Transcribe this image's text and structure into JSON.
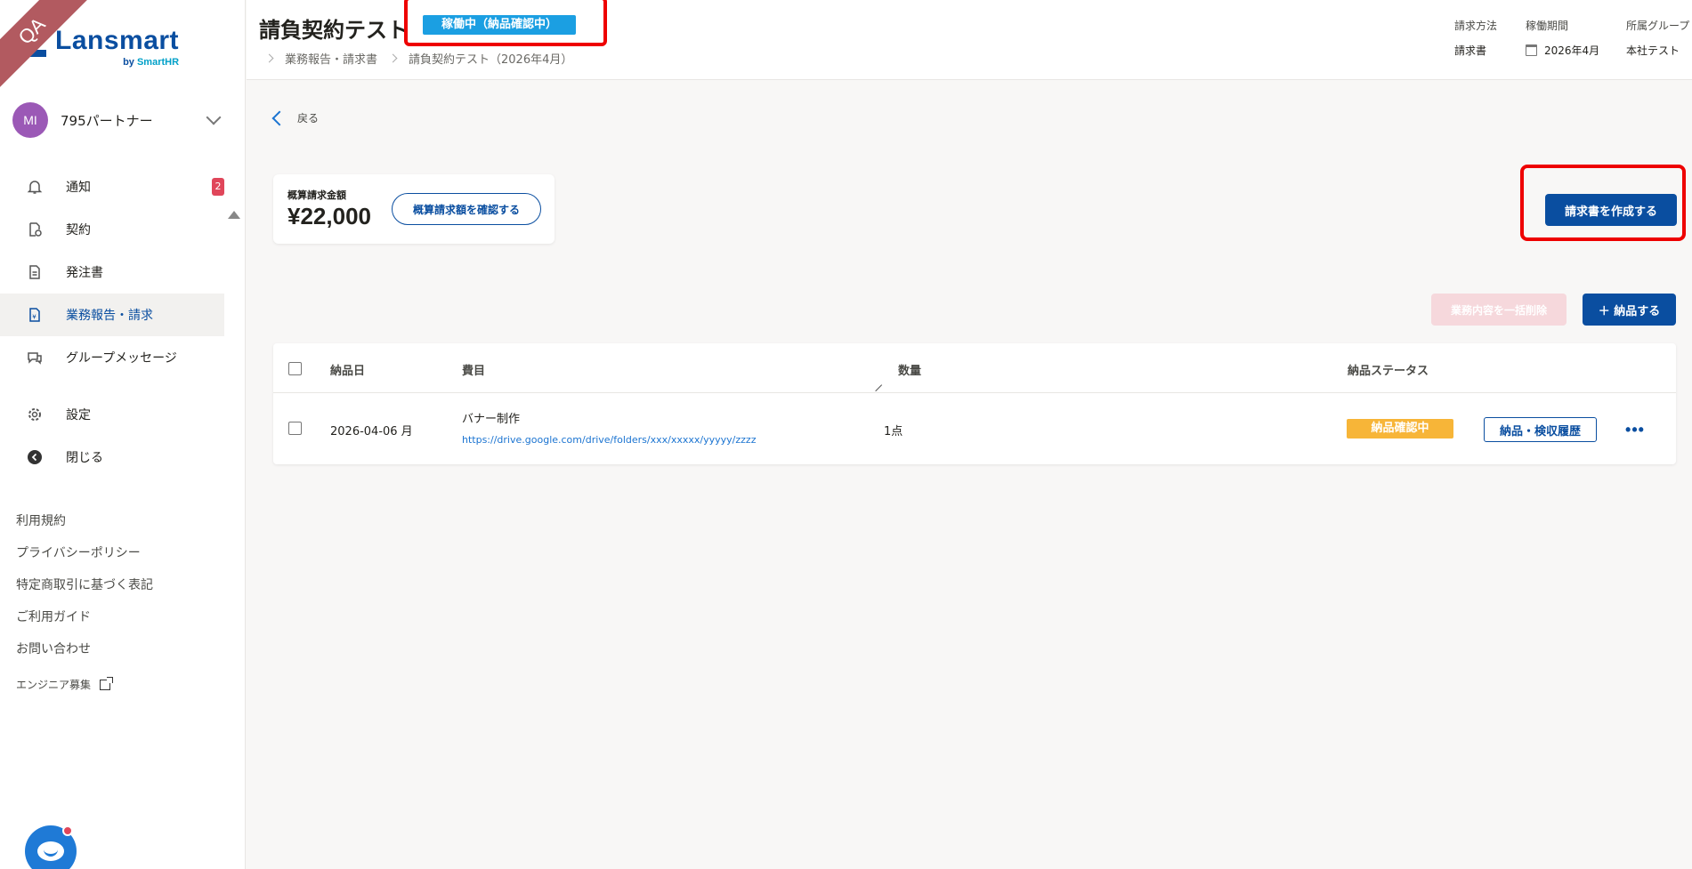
{
  "sidebar": {
    "qa_ribbon": "QA",
    "logo": {
      "name": "Lansmart",
      "by": "by ",
      "brand": "SmartHR"
    },
    "account": {
      "initials": "MI",
      "name": "795パートナー"
    },
    "nav": [
      {
        "label": "通知",
        "icon": "bell-icon",
        "badge": "2"
      },
      {
        "label": "契約",
        "icon": "contract-icon"
      },
      {
        "label": "発注書",
        "icon": "document-icon"
      },
      {
        "label": "業務報告・請求",
        "icon": "invoice-icon",
        "active": true
      },
      {
        "label": "グループメッセージ",
        "icon": "chat-icon"
      },
      {
        "label": "設定",
        "icon": "gear-icon"
      },
      {
        "label": "閉じる",
        "icon": "close-sidebar-icon"
      }
    ],
    "footer_links": [
      "利用規約",
      "プライバシーポリシー",
      "特定商取引に基づく表記",
      "ご利用ガイド",
      "お問い合わせ",
      "エンジニア募集"
    ]
  },
  "header": {
    "title": "請負契約テスト",
    "status": "稼働中（納品確認中）",
    "breadcrumb": [
      "業務報告・請求書",
      "請負契約テスト（2026年4月）"
    ],
    "meta": [
      {
        "label": "請求方法",
        "value": "請求書"
      },
      {
        "label": "稼働期間",
        "value": "2026年4月"
      },
      {
        "label": "所属グループ",
        "value": "本社テスト"
      }
    ]
  },
  "main": {
    "back_label": "戻る",
    "estimate": {
      "label": "概算請求金額",
      "amount": "¥22,000",
      "button": "概算請求額を確認する"
    },
    "create_invoice_button": "請求書を作成する",
    "bulk_delete_button": "業務内容を一括削除",
    "deliver_button": "＋ 納品する",
    "table": {
      "headers": [
        "納品日",
        "費目",
        "数量",
        "納品ステータス"
      ],
      "rows": [
        {
          "date": "2026-04-06 月",
          "item": "バナー制作",
          "link": "https://drive.google.com/drive/folders/xxx/xxxxx/yyyyy/zzzz",
          "quantity": "1点",
          "status": "納品確認中",
          "history_button": "納品・検収履歴",
          "more": "•••"
        }
      ]
    }
  },
  "colors": {
    "brand": "#0a4ea0",
    "status_active": "#1b9fe2",
    "status_pending": "#f7b538",
    "highlight": "#e00000",
    "badge": "#e0465a"
  }
}
